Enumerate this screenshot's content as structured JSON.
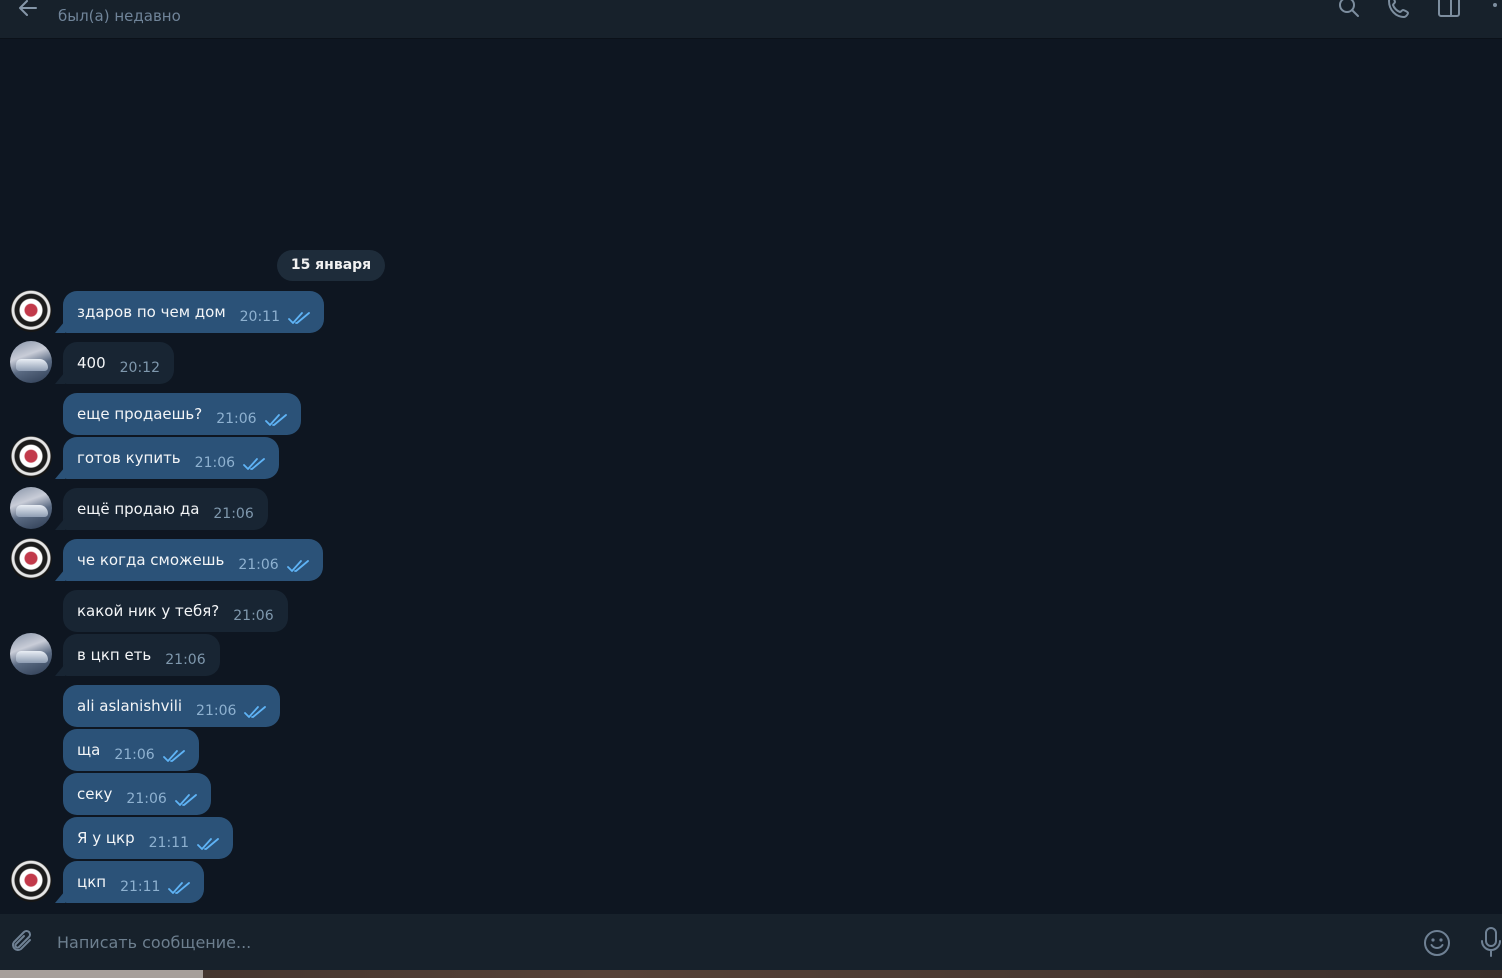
{
  "header": {
    "contact_name": "",
    "status": "был(а) недавно",
    "icons": [
      "back-arrow-icon",
      "search-icon",
      "phone-icon",
      "sidebar-toggle-icon",
      "more-vertical-icon"
    ]
  },
  "chat": {
    "date_separator": "15 января",
    "messages": [
      {
        "text": "здаров по чем дом",
        "time": "20:11",
        "dir": "out",
        "read": true
      },
      {
        "text": "400",
        "time": "20:12",
        "dir": "in"
      },
      {
        "text": "еще продаешь?",
        "time": "21:06",
        "dir": "out",
        "read": true
      },
      {
        "text": "готов купить",
        "time": "21:06",
        "dir": "out",
        "read": true
      },
      {
        "text": "ещё продаю да",
        "time": "21:06",
        "dir": "in"
      },
      {
        "text": "че когда сможешь",
        "time": "21:06",
        "dir": "out",
        "read": true
      },
      {
        "text": "какой ник у тебя?",
        "time": "21:06",
        "dir": "in"
      },
      {
        "text": "в цкп еть",
        "time": "21:06",
        "dir": "in"
      },
      {
        "text": "ali aslanishvili",
        "time": "21:06",
        "dir": "out",
        "read": true
      },
      {
        "text": "ща",
        "time": "21:06",
        "dir": "out",
        "read": true
      },
      {
        "text": "секу",
        "time": "21:06",
        "dir": "out",
        "read": true
      },
      {
        "text": "Я у цкр",
        "time": "21:11",
        "dir": "out",
        "read": true
      },
      {
        "text": "цкп",
        "time": "21:11",
        "dir": "out",
        "read": true
      }
    ]
  },
  "composer": {
    "placeholder": "Написать сообщение...",
    "icons": [
      "paperclip-icon",
      "emoji-icon",
      "microphone-icon"
    ]
  },
  "colors": {
    "background": "#0e1621",
    "header": "#17212b",
    "outgoing_bubble": "#2b5278",
    "incoming_bubble": "#182533",
    "read_check": "#5fb3f5"
  }
}
